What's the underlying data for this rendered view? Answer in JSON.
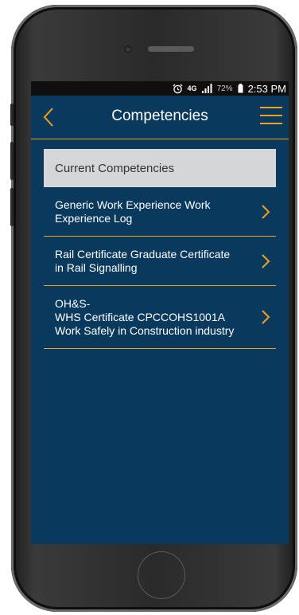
{
  "status_bar": {
    "network": "4G",
    "battery_percent": "72%",
    "time": "2:53 PM"
  },
  "header": {
    "title": "Competencies"
  },
  "section": {
    "label": "Current Competencies"
  },
  "competencies": [
    {
      "lines": [
        "Generic Work Experience Work",
        "Experience Log"
      ]
    },
    {
      "lines": [
        "Rail Certificate Graduate Certificate",
        "in Rail Signalling"
      ]
    },
    {
      "lines": [
        "OH&S-",
        "WHS Certificate CPCCOHS1001A",
        "Work Safely in Construction industry"
      ]
    }
  ],
  "colors": {
    "background": "#093a5e",
    "accent": "#f3a11b",
    "section_bg": "#d5d6d8"
  },
  "icons": [
    "alarm-icon",
    "signal-icon",
    "battery-icon",
    "back-chevron-icon",
    "hamburger-menu-icon",
    "chevron-right-icon"
  ]
}
